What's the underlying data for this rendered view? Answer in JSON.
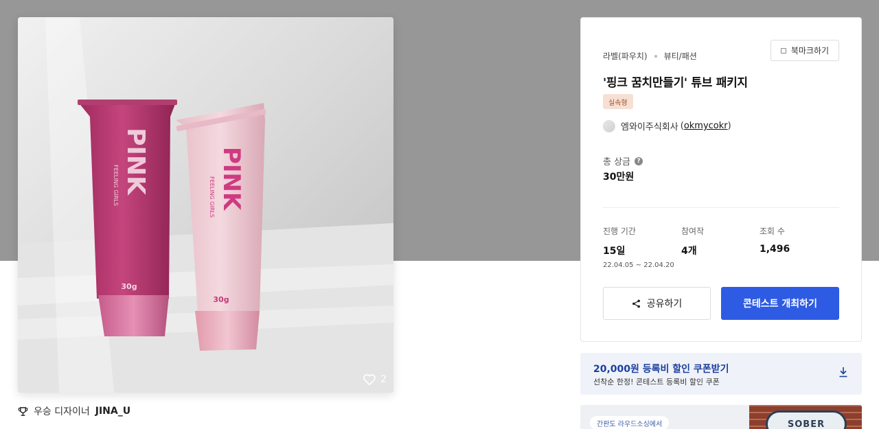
{
  "product_image": {
    "tube_left_text": "PINK",
    "tube_left_sub": "FEELING GIRLS",
    "tube_left_weight": "30g",
    "tube_right_text": "PINK",
    "tube_right_sub": "FEELING GIRLS",
    "tube_right_weight": "30g",
    "like_count": "2"
  },
  "winner": {
    "label": "우승 디자이너",
    "name": "JINA_U"
  },
  "contest": {
    "category": "라벨(파우치)",
    "subcategory": "뷰티/패션",
    "bookmark_label": "북마크하기",
    "title": "'핑크 꿈치만들기' 튜브 패키지",
    "badge": "실속형",
    "host_name": "엠와이주식회사",
    "host_handle": "okmycokr",
    "prize_label": "총 상금",
    "prize_value": "30만원",
    "stats": {
      "period_label": "진행 기간",
      "period_value": "15일",
      "period_dates": "22.04.05 ~ 22.04.20",
      "entries_label": "참여작",
      "entries_value": "4개",
      "views_label": "조회 수",
      "views_value": "1,496"
    },
    "share_label": "공유하기",
    "host_button_label": "콘테스트 개최하기"
  },
  "coupon": {
    "title": "20,000원 등록비 할인 쿠폰받기",
    "subtitle": "선착순 한정! 콘테스트 등록비 할인 쿠폰"
  },
  "banner": {
    "pill": "간판도 라우드소싱에서",
    "sign_text": "SOBER"
  },
  "colors": {
    "primary": "#2d5be3",
    "badge_bg": "#f6e0d4",
    "coupon_title": "#1d3f9e",
    "hero_band": "#979797"
  }
}
